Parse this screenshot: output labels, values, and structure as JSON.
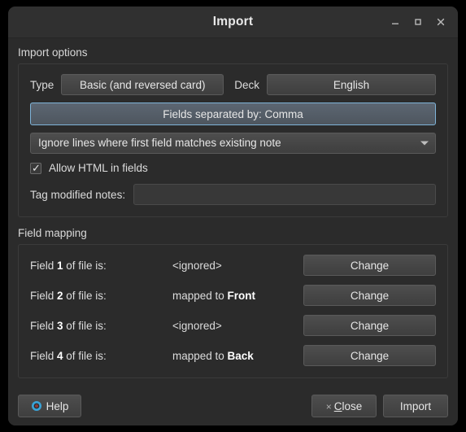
{
  "window": {
    "title": "Import",
    "controls": {
      "minimize": "minimize-icon",
      "maximize": "maximize-icon",
      "close": "close-icon"
    }
  },
  "import_options": {
    "group_title": "Import options",
    "type_label": "Type",
    "type_value": "Basic (and reversed card)",
    "deck_label": "Deck",
    "deck_value": "English",
    "separator_button": "Fields separated by: Comma",
    "existing_notes_value": "Ignore lines where first field matches existing note",
    "allow_html_label": "Allow HTML in fields",
    "allow_html_checked": "✓",
    "tag_label": "Tag modified notes:",
    "tag_value": "",
    "tag_placeholder": ""
  },
  "field_mapping": {
    "group_title": "Field mapping",
    "change_label": "Change",
    "rows": [
      {
        "prefix": "Field ",
        "index": "1",
        "suffix": " of file is:",
        "value_prefix": "",
        "value": "<ignored>",
        "value_bold": ""
      },
      {
        "prefix": "Field ",
        "index": "2",
        "suffix": " of file is:",
        "value_prefix": "mapped to ",
        "value": "",
        "value_bold": "Front"
      },
      {
        "prefix": "Field ",
        "index": "3",
        "suffix": " of file is:",
        "value_prefix": "",
        "value": "<ignored>",
        "value_bold": ""
      },
      {
        "prefix": "Field ",
        "index": "4",
        "suffix": " of file is:",
        "value_prefix": "mapped to ",
        "value": "",
        "value_bold": "Back"
      }
    ]
  },
  "footer": {
    "help_label": "Help",
    "help_icon": "help-target-icon",
    "close_prefix": "×",
    "close_accel": "C",
    "close_rest": "lose",
    "import_label": "Import"
  },
  "colors": {
    "window_bg": "#2b2b2b",
    "titlebar_bg": "#303030",
    "button_bg": "#474747",
    "focus_border": "#7eb3d8",
    "text": "#e6e6e6",
    "help_icon_blue": "#3aa3d8",
    "help_icon_center": "#8a3b3b"
  }
}
